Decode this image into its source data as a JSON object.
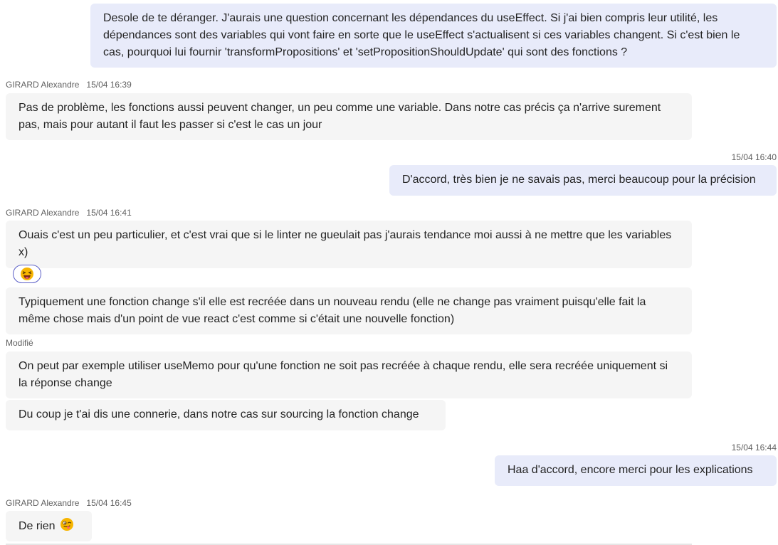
{
  "messages": {
    "m1": {
      "text": "Desole de te déranger. J'aurais une question concernant les dépendances du useEffect. Si j'ai bien compris leur utilité, les dépendances sont des variables qui vont faire en sorte que le useEffect s'actualisent si ces variables changent. Si c'est bien le cas, pourquoi lui fournir 'transformPropositions' et 'setPropositionShouldUpdate' qui sont des fonctions ?"
    },
    "meta2": {
      "author": "GIRARD Alexandre",
      "time": "15/04 16:39"
    },
    "m2": {
      "text": "Pas de problème, les fonctions aussi peuvent changer, un peu comme une variable. Dans notre cas précis ça n'arrive surement pas, mais pour autant il faut les passer si c'est le cas un jour"
    },
    "meta3": {
      "time": "15/04 16:40"
    },
    "m3": {
      "text": "D'accord, très bien je ne savais pas, merci beaucoup pour la précision"
    },
    "meta4": {
      "author": "GIRARD Alexandre",
      "time": "15/04 16:41"
    },
    "m4": {
      "text": "Ouais c'est un peu particulier, et c'est vrai que si le linter ne gueulait pas j'aurais tendance moi aussi à ne mettre que les variables x)"
    },
    "m4_reaction": "laughing-emoji",
    "m5": {
      "text": "Typiquement une fonction change s'il elle est recréée dans un nouveau rendu (elle ne change pas vraiment puisqu'elle fait la même chose mais d'un point de vue react c'est comme si c'était une nouvelle fonction)"
    },
    "edited_label": "Modifié",
    "m6": {
      "text": "On peut par exemple utiliser useMemo pour qu'une fonction ne soit pas recréée à chaque rendu, elle sera recréée uniquement si la réponse change"
    },
    "m7": {
      "text": "Du coup je t'ai dis une connerie, dans notre cas sur sourcing la fonction change"
    },
    "meta8": {
      "time": "15/04 16:44"
    },
    "m8": {
      "text": "Haa d'accord, encore merci pour les explications"
    },
    "meta9": {
      "author": "GIRARD Alexandre",
      "time": "15/04 16:45"
    },
    "m9": {
      "text": "De rien",
      "emoji": "winking-tongue-emoji"
    }
  },
  "colors": {
    "outgoing_bubble": "#e8ebfa",
    "incoming_bubble": "#f5f5f5",
    "reaction_border": "#5b5fc7",
    "meta_text": "#616161"
  }
}
